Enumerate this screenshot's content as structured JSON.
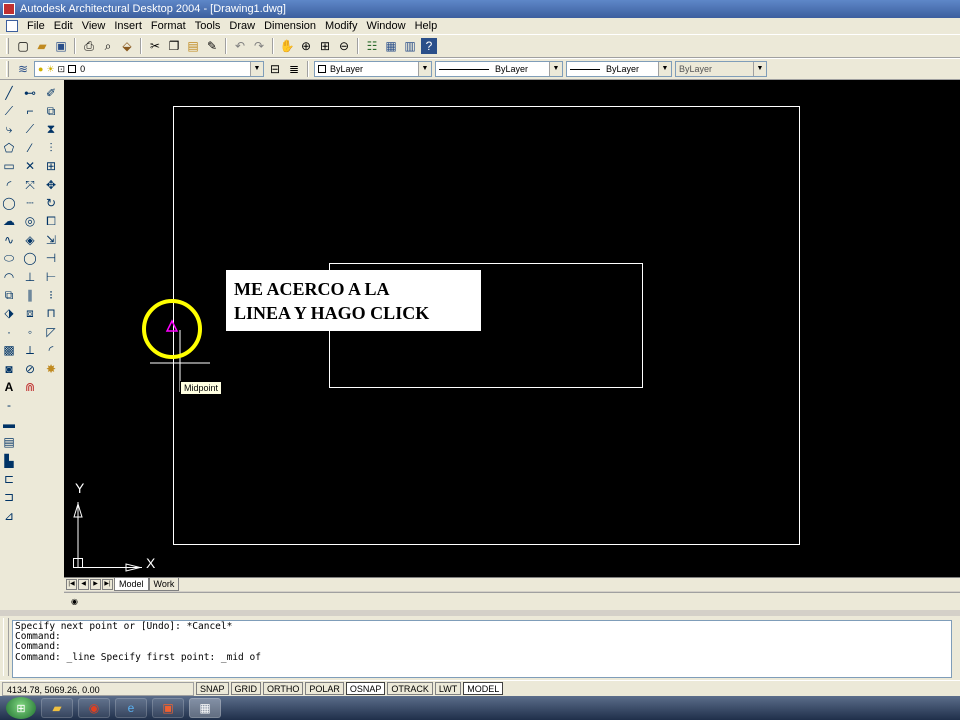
{
  "window": {
    "title": "Autodesk Architectural Desktop 2004 - [Drawing1.dwg]"
  },
  "menu": [
    "File",
    "Edit",
    "View",
    "Insert",
    "Format",
    "Tools",
    "Draw",
    "Dimension",
    "Modify",
    "Window",
    "Help"
  ],
  "properties": {
    "layer_value": "0",
    "color_value": "ByLayer",
    "linetype_value": "ByLayer",
    "lineweight_value": "ByLayer",
    "plotstyle_value": "ByLayer"
  },
  "canvas": {
    "annotation_text_line1": "ME ACERCO A LA",
    "annotation_text_line2": "LINEA Y HAGO CLICK",
    "snap_tooltip": "Midpoint",
    "ucs_x_label": "X",
    "ucs_y_label": "Y",
    "colors": {
      "background": "#000000",
      "drawing_lines": "#ffffff",
      "marker": "#ff00ff",
      "highlight_circle": "#ffff00",
      "tooltip_bg": "#ffffe1"
    }
  },
  "layout_tabs": [
    "Model",
    "Work"
  ],
  "command_history": [
    "Specify next point or [Undo]: *Cancel*",
    "Command:",
    "Command:",
    "",
    "Command: _line Specify first point: _mid of"
  ],
  "status": {
    "coordinates": "4134.78, 5069.26, 0.00",
    "buttons": [
      {
        "label": "SNAP",
        "on": false
      },
      {
        "label": "GRID",
        "on": false
      },
      {
        "label": "ORTHO",
        "on": false
      },
      {
        "label": "POLAR",
        "on": false
      },
      {
        "label": "OSNAP",
        "on": true
      },
      {
        "label": "OTRACK",
        "on": false
      },
      {
        "label": "LWT",
        "on": false
      },
      {
        "label": "MODEL",
        "on": true
      }
    ]
  },
  "icons": {
    "toolbar1": [
      "new-icon",
      "open-icon",
      "save-icon",
      "print-icon",
      "preview-icon",
      "publish-icon",
      "cut-icon",
      "copy-icon",
      "paste-icon",
      "match-properties-icon",
      "undo-icon",
      "redo-icon",
      "pan-icon",
      "zoom-realtime-icon",
      "zoom-window-icon",
      "zoom-previous-icon",
      "properties-icon",
      "design-center-icon",
      "tool-palettes-icon",
      "help-icon"
    ],
    "draw": [
      "line-icon",
      "construction-line-icon",
      "polyline-icon",
      "polygon-icon",
      "rectangle-icon",
      "arc-icon",
      "circle-icon",
      "revision-cloud-icon",
      "spline-icon",
      "ellipse-icon",
      "ellipse-arc-icon",
      "insert-block-icon",
      "make-block-icon",
      "point-icon",
      "hatch-icon",
      "region-icon",
      "multiline-text-icon"
    ],
    "modify": [
      "erase-icon",
      "copy-object-icon",
      "mirror-icon",
      "offset-icon",
      "array-icon",
      "move-icon",
      "rotate-icon",
      "scale-icon",
      "stretch-icon",
      "trim-icon",
      "extend-icon",
      "break-at-point-icon",
      "break-icon",
      "chamfer-icon",
      "fillet-icon",
      "explode-icon"
    ]
  }
}
